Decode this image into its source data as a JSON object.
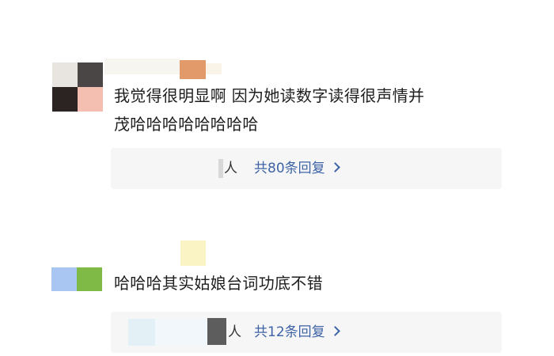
{
  "comments": [
    {
      "text_line1": "我觉得很明显啊 因为她读数字读得很声情并",
      "text_line2": "茂哈哈哈哈哈哈哈哈",
      "reply_user_fragment": "人",
      "reply_link": "共80条回复",
      "reply_chevron_icon": "chevron-right-icon"
    },
    {
      "text_line1": "哈哈哈其实姑娘台词功底不错",
      "reply_user_fragment": "人",
      "reply_link": "共12条回复",
      "reply_chevron_icon": "chevron-right-icon"
    }
  ],
  "colors": {
    "link": "#3e63a6",
    "text": "#1e1e1e",
    "reply_bg": "#f6f6f7",
    "background": "#ffffff"
  }
}
